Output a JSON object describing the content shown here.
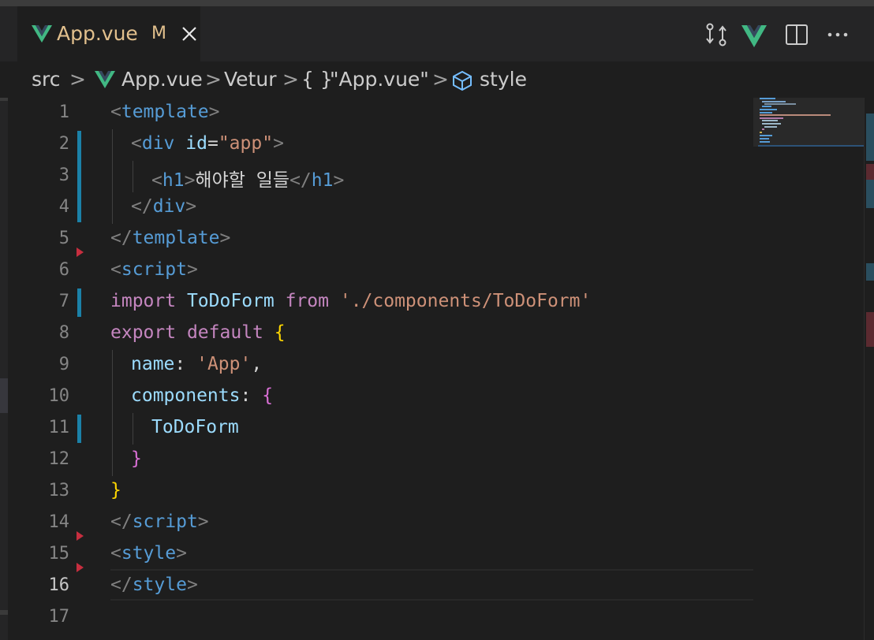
{
  "tab": {
    "icon": "vue-icon",
    "label": "App.vue",
    "status": "M",
    "close_icon": "close-icon",
    "color": "#e2c08d"
  },
  "actions": [
    {
      "name": "open-changes-icon"
    },
    {
      "name": "vue-icon"
    },
    {
      "name": "split-editor-icon"
    },
    {
      "name": "more-actions-icon"
    }
  ],
  "breadcrumb": {
    "items": [
      {
        "label": "src",
        "icon": null
      },
      {
        "label": "App.vue",
        "icon": "vue-icon"
      },
      {
        "label": "Vetur",
        "icon": null
      },
      {
        "label": "\"App.vue\"",
        "icon": "braces-icon",
        "icon_text": "{ }"
      },
      {
        "label": "style",
        "icon": "cube-icon"
      }
    ],
    "separator": ">"
  },
  "editor": {
    "active_line": 16,
    "lines": [
      {
        "n": "1"
      },
      {
        "n": "2"
      },
      {
        "n": "3"
      },
      {
        "n": "4"
      },
      {
        "n": "5"
      },
      {
        "n": "6"
      },
      {
        "n": "7"
      },
      {
        "n": "8"
      },
      {
        "n": "9"
      },
      {
        "n": "10"
      },
      {
        "n": "11"
      },
      {
        "n": "12"
      },
      {
        "n": "13"
      },
      {
        "n": "14"
      },
      {
        "n": "15"
      },
      {
        "n": "16"
      },
      {
        "n": "17"
      }
    ],
    "code": {
      "l1": {
        "lt": "<",
        "tag": "template",
        "gt": ">"
      },
      "l2": {
        "lt": "<",
        "tag": "div",
        "attr": "id",
        "eq": "=",
        "val": "\"app\"",
        "gt": ">"
      },
      "l3": {
        "lt": "<",
        "tag": "h1",
        "gt": ">",
        "text": "해야할 일들",
        "lt2": "</",
        "tag2": "h1",
        "gt2": ">"
      },
      "l4": {
        "lt": "</",
        "tag": "div",
        "gt": ">"
      },
      "l5": {
        "lt": "</",
        "tag": "template",
        "gt": ">"
      },
      "l6": {
        "lt": "<",
        "tag": "script",
        "gt": ">"
      },
      "l7": {
        "kw1": "import",
        "id": "ToDoForm",
        "kw2": "from",
        "str": "'./components/ToDoForm'"
      },
      "l8": {
        "kw1": "export",
        "kw2": "default",
        "brace": "{"
      },
      "l9": {
        "key": "name",
        "colon": ":",
        "str": "'App'",
        "comma": ","
      },
      "l10": {
        "key": "components",
        "colon": ":",
        "brace": "{"
      },
      "l11": {
        "id": "ToDoForm"
      },
      "l12": {
        "brace": "}"
      },
      "l13": {
        "brace": "}"
      },
      "l14": {
        "lt": "</",
        "tag": "script",
        "gt": ">"
      },
      "l15": {
        "lt": "<",
        "tag": "style",
        "gt": ">"
      },
      "l16": {
        "lt": "</",
        "tag": "style",
        "gt": ">"
      }
    }
  },
  "colors": {
    "background": "#1e1e1e",
    "tag": "#569cd6",
    "attribute": "#9cdcfe",
    "string": "#ce9178",
    "keyword": "#c586c0",
    "bracket_gold": "#ffd700",
    "bracket_purple": "#da70d6",
    "gutter_modified": "#1b81a8",
    "gutter_deleted": "#c72e3f",
    "vue_green": "#41b883"
  }
}
